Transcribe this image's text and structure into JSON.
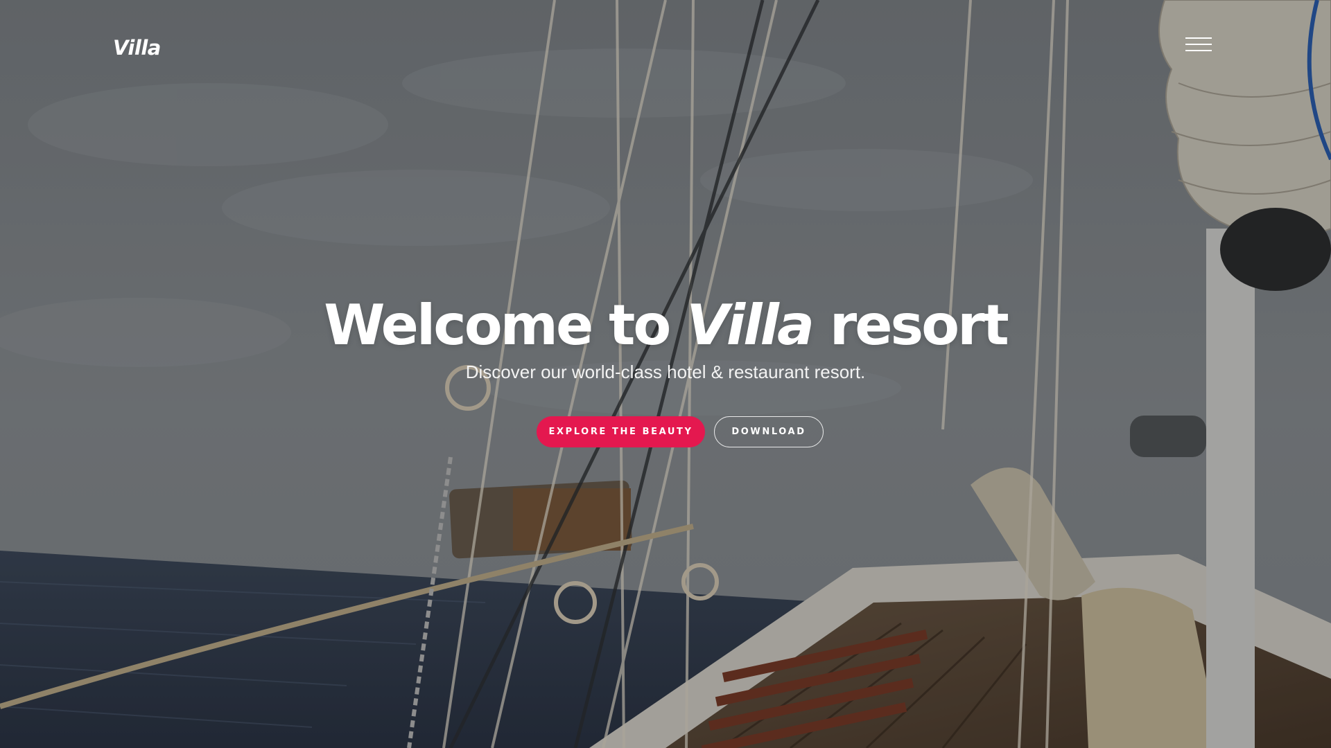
{
  "header": {
    "brand": "Villa",
    "menu_icon": "hamburger-menu-icon"
  },
  "hero": {
    "title_prefix": "Welcome to ",
    "title_brand": "Villa",
    "title_suffix": " resort",
    "subtitle": "Discover our world-class hotel & restaurant resort.",
    "primary_cta": "EXPLORE THE BEAUTY",
    "secondary_cta": "DOWNLOAD"
  },
  "colors": {
    "accent": "#e4184f",
    "text": "#ffffff"
  }
}
